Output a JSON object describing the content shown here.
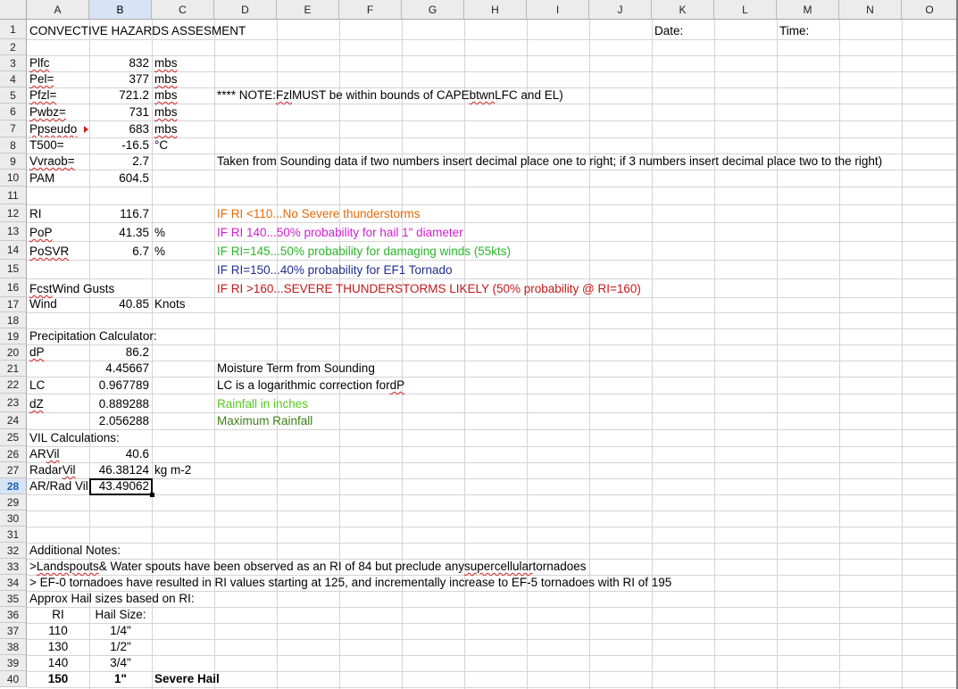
{
  "columns": [
    "A",
    "B",
    "C",
    "D",
    "E",
    "F",
    "G",
    "H",
    "I",
    "J",
    "K",
    "L",
    "M",
    "N",
    "O"
  ],
  "selected_column": "B",
  "selected_row": "28",
  "rows": [
    "1",
    "2",
    "3",
    "4",
    "5",
    "6",
    "7",
    "8",
    "9",
    "10",
    "11",
    "12",
    "13",
    "14",
    "15",
    "16",
    "17",
    "18",
    "19",
    "20",
    "21",
    "22",
    "23",
    "24",
    "25",
    "26",
    "27",
    "28",
    "29",
    "30",
    "31",
    "32",
    "33",
    "34",
    "35",
    "36",
    "37",
    "38",
    "39",
    "40"
  ],
  "cells": {
    "A1": "CONVECTIVE HAZARDS ASSESMENT",
    "K1": "Date:",
    "M1": "Time:",
    "A3": "Plfc",
    "B3": "832",
    "C3": "mbs",
    "A4": "Pel=",
    "B4": "377",
    "C4": "mbs",
    "A5": "Pfzl=",
    "B5": "721.2",
    "C5": "mbs",
    "D5_pre": "**** NOTE: ",
    "D5_fzl": "Fzl",
    "D5_mid": " MUST be within bounds of CAPE ",
    "D5_btwn": "btwn",
    "D5_post": " LFC and EL)",
    "A6": "Pwbz=",
    "B6": "731",
    "C6": "mbs",
    "A7": "Ppseudo",
    "B7": "683",
    "C7": "mbs",
    "A8": "T500=",
    "B8": "-16.5",
    "C8": "°C",
    "A9": "Vvraob=",
    "B9": "2.7",
    "D9": "Taken from Sounding data if two numbers insert decimal place one to right; if 3 numbers insert decimal place two to the right)",
    "A10": "PAM",
    "B10": "604.5",
    "A12": "RI",
    "B12": "116.7",
    "D12_a": "IF RI <110",
    "D12_b": "...No Severe thunderstorms",
    "A13": "PoP",
    "B13": "41.35",
    "C13": "%",
    "D13_a": "IF RI 140 ",
    "D13_b": "...50% probability for hail 1\" diameter",
    "A14": "PoSVR",
    "B14": "6.7",
    "C14": "%",
    "D14_a": "IF RI=145",
    "D14_b": "...50% probability for damaging winds (55kts)",
    "D15_a": "IF RI=150",
    "D15_b": "...40% probability for EF1 Tornado",
    "A16_a": "Fcst",
    "A16_b": " Wind Gusts",
    "D16_a": "IF RI >160",
    "D16_b": "...SEVERE THUNDERSTORMS LIKELY (50% probability @ RI=160)",
    "A17": "Wind",
    "B17": "40.85",
    "C17": "Knots",
    "A19": "Precipitation Calculator:",
    "A20": "dP",
    "B20": "86.2",
    "B21": "4.45667",
    "D21": "Moisture Term from Sounding",
    "A22": "LC",
    "B22": "0.967789",
    "D22_a": "LC is a logarithmic correction for ",
    "D22_b": "dP",
    "A23": "dZ",
    "B23": "0.889288",
    "D23": "Rainfall in inches",
    "B24": "2.056288",
    "D24": "Maximum Rainfall",
    "A25": "VIL Calculations:",
    "A26_a": "AR ",
    "A26_b": "Vil",
    "B26": "40.6",
    "A27_a": "Radar ",
    "A27_b": "Vil",
    "B27": "46.38124",
    "C27": "kg m-2",
    "A28": "AR/Rad Vil",
    "B28": "43.49062",
    "A32": "Additional Notes:",
    "A33_a": " > ",
    "A33_b": "Landspouts",
    "A33_c": " & Water spouts have been observed as an RI of 84 but preclude any ",
    "A33_d": "supercellular",
    "A33_e": " tornadoes",
    "A34": "> EF-0 tornadoes have resulted in RI values starting at 125, and incrementally increase to EF-5 tornadoes with RI of 195",
    "A35": "Approx Hail sizes based on RI:",
    "A36": "RI",
    "B36": "Hail Size:",
    "A37": "110",
    "B37": "1/4\"",
    "A38": "130",
    "B38": "1/2\"",
    "A39": "140",
    "B39": "3/4\"",
    "A40": "150",
    "B40": "1\"",
    "C40": "Severe Hail"
  }
}
